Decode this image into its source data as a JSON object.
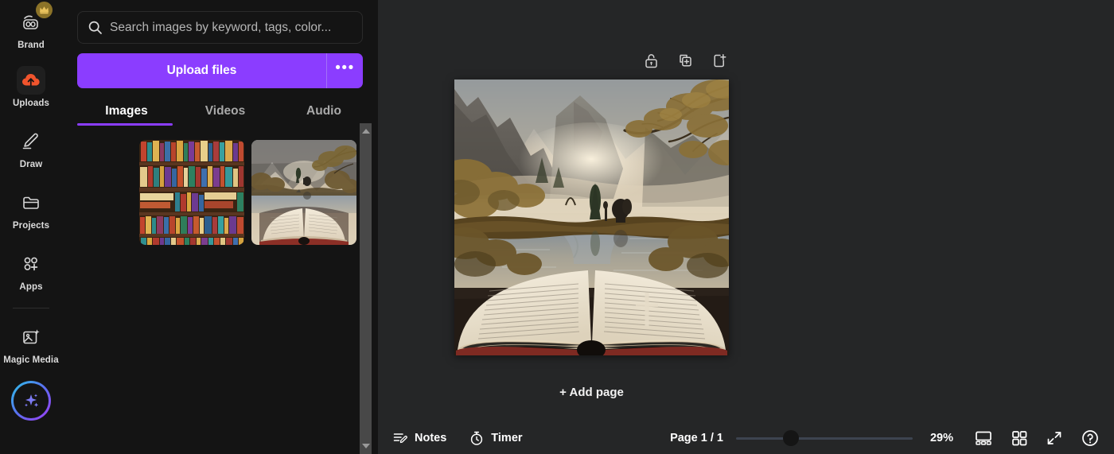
{
  "rail": {
    "items": [
      {
        "label": "Brand",
        "icon": "brand-icon",
        "active": false,
        "badge": "crown-badge"
      },
      {
        "label": "Uploads",
        "icon": "uploads-cloud-icon",
        "active": true
      },
      {
        "label": "Draw",
        "icon": "draw-pen-icon",
        "active": false
      },
      {
        "label": "Projects",
        "icon": "folder-icon",
        "active": false
      },
      {
        "label": "Apps",
        "icon": "apps-grid-plus-icon",
        "active": false
      },
      {
        "label": "Magic Media",
        "icon": "magic-media-icon",
        "active": false
      }
    ],
    "ai_button": {
      "name": "ai-sparkle-button",
      "icon": "sparkles-icon"
    }
  },
  "panel": {
    "search": {
      "placeholder": "Search images by keyword, tags, color...",
      "value": "",
      "icon": "search-icon"
    },
    "upload_button": {
      "label": "Upload files"
    },
    "upload_more_button": {
      "label": "•••"
    },
    "tabs": [
      {
        "label": "Images",
        "active": true
      },
      {
        "label": "Videos",
        "active": false
      },
      {
        "label": "Audio",
        "active": false
      }
    ],
    "thumbnails": [
      {
        "name": "bookshelf-thumbnail",
        "alt": "Colorful bookshelf full of books"
      },
      {
        "name": "open-book-landscape-thumbnail",
        "alt": "Open book with misty mountain lake landscape"
      }
    ]
  },
  "editor": {
    "float_tools": [
      {
        "name": "lock-page-button",
        "icon": "unlock-icon"
      },
      {
        "name": "duplicate-page-button",
        "icon": "duplicate-icon"
      },
      {
        "name": "add-page-button",
        "icon": "add-page-icon"
      }
    ],
    "canvas": {
      "name": "design-canvas",
      "alt": "Open book on misty mountain lake landscape"
    },
    "add_page_label": "+ Add page"
  },
  "bottombar": {
    "notes": {
      "label": "Notes",
      "icon": "notes-icon"
    },
    "timer": {
      "label": "Timer",
      "icon": "timer-icon"
    },
    "page_indicator": "Page 1 / 1",
    "zoom": {
      "value": "29%",
      "percent": 29
    },
    "icons": [
      {
        "name": "presenter-view-button",
        "icon": "presenter-view-icon"
      },
      {
        "name": "grid-view-button",
        "icon": "grid-view-icon"
      },
      {
        "name": "fullscreen-button",
        "icon": "fullscreen-icon"
      },
      {
        "name": "help-button",
        "icon": "help-icon"
      }
    ]
  },
  "colors": {
    "accent_purple": "#8b3dff",
    "panel_bg": "#141414",
    "editor_bg": "#252627",
    "upload_cloud": "#f0542d",
    "crown": "#e0b74a"
  }
}
